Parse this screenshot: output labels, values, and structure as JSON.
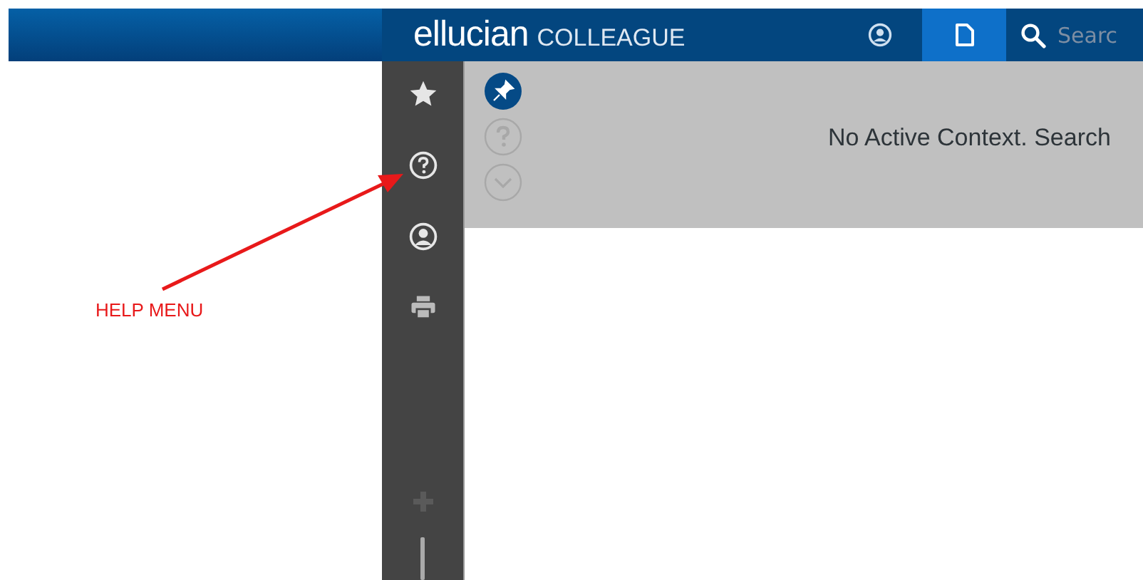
{
  "header": {
    "brand": "ellucian",
    "product": "COLLEAGUE",
    "tabs": [
      {
        "kind": "person",
        "selected": false
      },
      {
        "kind": "document",
        "selected": true
      }
    ],
    "search": {
      "placeholder": "Searc"
    }
  },
  "context": {
    "message": "No Active Context. Search"
  },
  "annotation": {
    "label": "HELP MENU"
  }
}
